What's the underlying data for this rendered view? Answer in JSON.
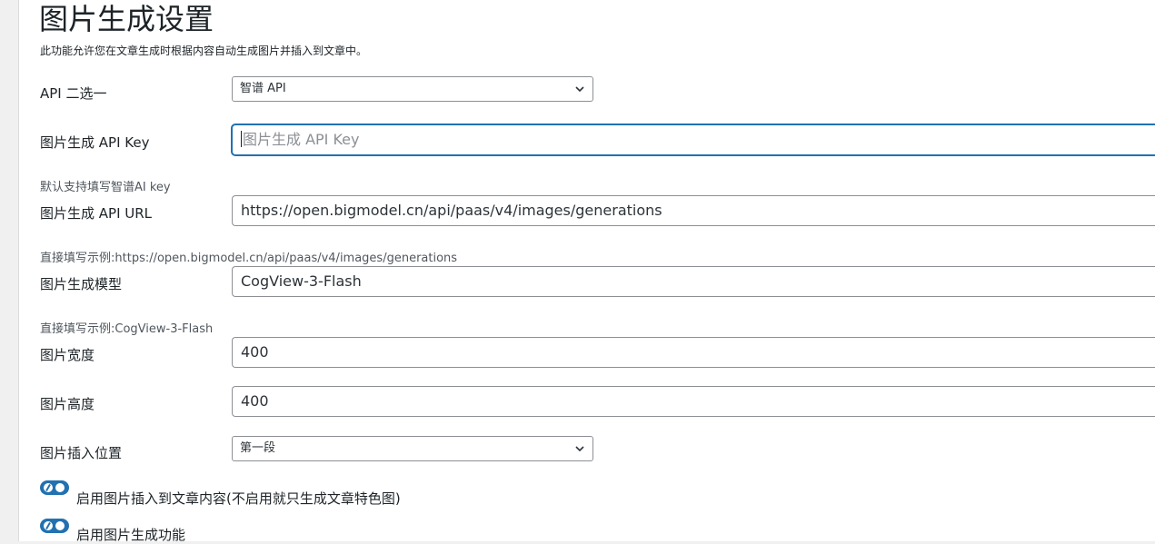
{
  "page": {
    "title": "图片生成设置",
    "description": "此功能允许您在文章生成时根据内容自动生成图片并插入到文章中。"
  },
  "fields": {
    "api_choice": {
      "label": "API 二选一",
      "value": "智谱 API"
    },
    "api_key": {
      "label": "图片生成 API Key",
      "placeholder": "图片生成 API Key",
      "hint": "默认支持填写智谱AI key"
    },
    "api_url": {
      "label": "图片生成 API URL",
      "value": "https://open.bigmodel.cn/api/paas/v4/images/generations",
      "hint": "直接填写示例:https://open.bigmodel.cn/api/paas/v4/images/generations"
    },
    "model": {
      "label": "图片生成模型",
      "value": "CogView-3-Flash",
      "hint": "直接填写示例:CogView-3-Flash"
    },
    "width": {
      "label": "图片宽度",
      "value": "400"
    },
    "height": {
      "label": "图片高度",
      "value": "400"
    },
    "position": {
      "label": "图片插入位置",
      "value": "第一段"
    }
  },
  "toggles": [
    {
      "label": "启用图片插入到文章内容(不启用就只生成文章特色图)",
      "enabled": true
    },
    {
      "label": "启用图片生成功能",
      "enabled": true
    }
  ],
  "colors": {
    "accent": "#2271b1",
    "border": "#8c8f94"
  }
}
